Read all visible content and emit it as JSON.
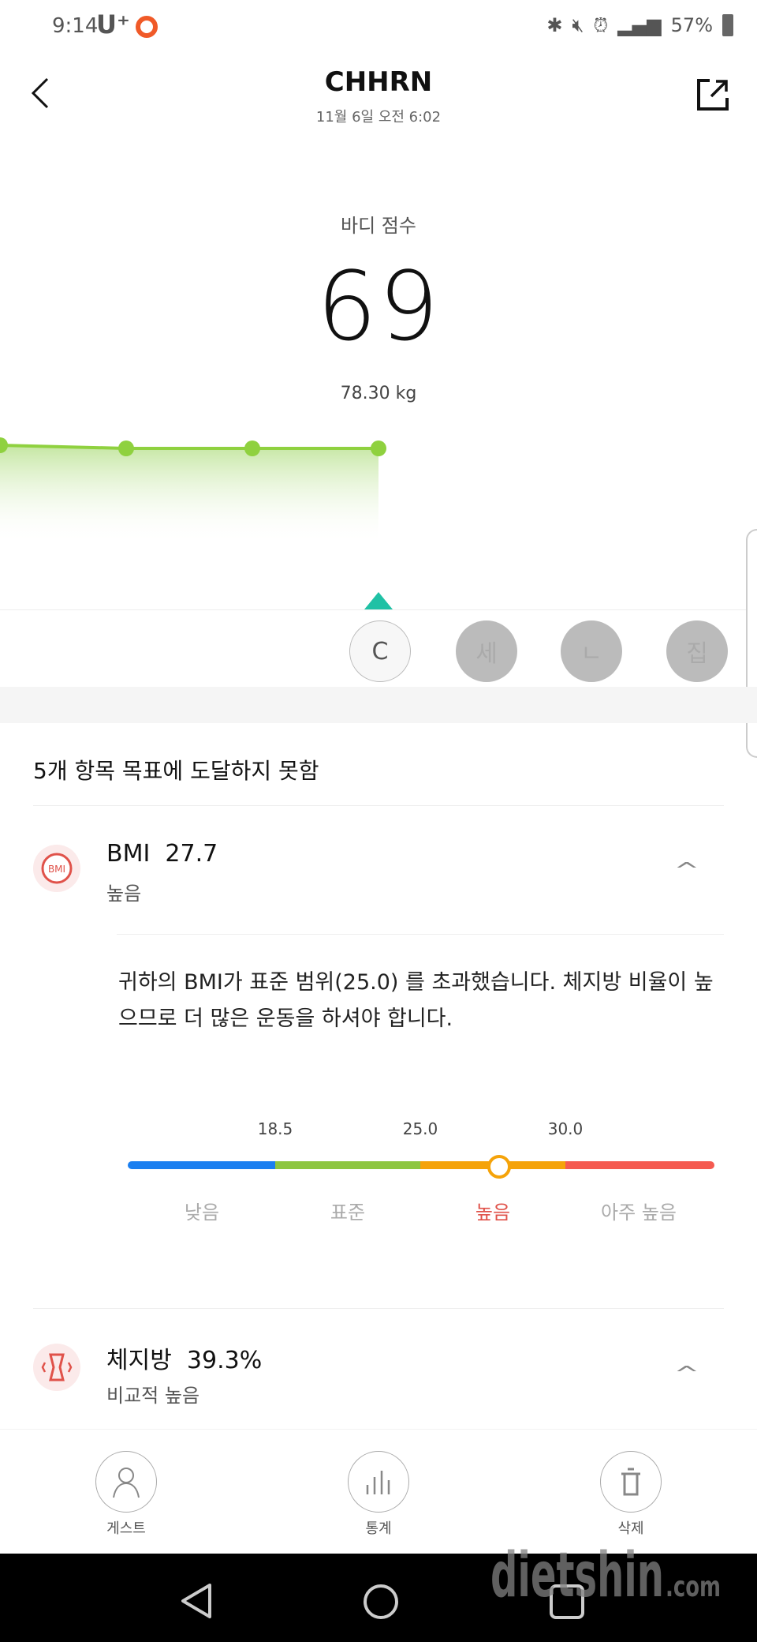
{
  "status_bar": {
    "time": "9:14",
    "carrier": "U⁺",
    "battery": "57%"
  },
  "header": {
    "title": "CHHRN",
    "date": "11월 6일 오전 6:02"
  },
  "summary": {
    "label": "바디 점수",
    "score": "69",
    "weight": "78.30 kg"
  },
  "trend": {
    "values": [
      69,
      69,
      69,
      69
    ],
    "line_color": "#8fd13f"
  },
  "users": [
    {
      "label": "C",
      "selected": true
    },
    {
      "label": "세",
      "selected": false
    },
    {
      "label": "ㄴ",
      "selected": false
    },
    {
      "label": "집",
      "selected": false
    }
  ],
  "goal_text": "5개 항목 목표에 도달하지 못함",
  "items": [
    {
      "icon": "bmi-icon",
      "icon_text": "BMI",
      "name": "BMI",
      "value": "27.7",
      "status": "높음"
    },
    {
      "icon": "body-fat-icon",
      "name": "체지방",
      "value": "39.3%",
      "status": "비교적 높음"
    }
  ],
  "bmi_detail": {
    "description": "귀하의 BMI가 표준 범위(25.0) 를 초과했습니다. 체지방 비율이 높으므로 더 많은 운동을 하셔야 합니다.",
    "thresholds": [
      "18.5",
      "25.0",
      "30.0"
    ],
    "levels": [
      "낮음",
      "표준",
      "높음",
      "아주 높음"
    ],
    "current_level": "높음",
    "value": 27.7,
    "colors": [
      "#1a7ff0",
      "#8dc63f",
      "#f5a30a",
      "#f55a50"
    ]
  },
  "actions": [
    {
      "label": "게스트",
      "icon": "person-icon"
    },
    {
      "label": "통계",
      "icon": "stats-icon"
    },
    {
      "label": "삭제",
      "icon": "trash-icon"
    }
  ],
  "watermark": {
    "text": "dietshin",
    ".com": ".com"
  }
}
